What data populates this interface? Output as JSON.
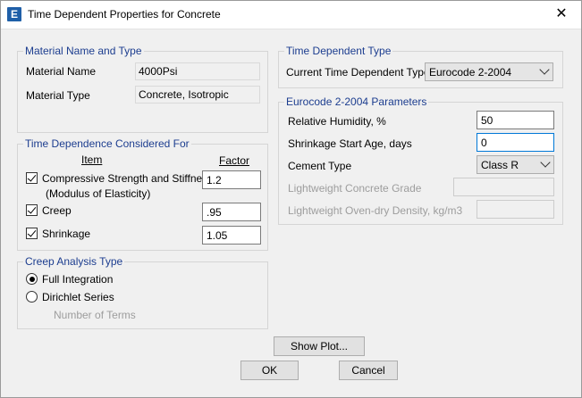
{
  "window": {
    "title": "Time Dependent Properties for Concrete",
    "icon_letter": "E",
    "icon": "etabs-app-icon",
    "close": "✕"
  },
  "material": {
    "group_title": "Material Name and Type",
    "name_label": "Material Name",
    "name_value": "4000Psi",
    "type_label": "Material Type",
    "type_value": "Concrete, Isotropic"
  },
  "time_dependence": {
    "group_title": "Time Dependence Considered For",
    "item_header": "Item",
    "factor_header": "Factor",
    "items": [
      {
        "label": "Compressive Strength and Stiffness",
        "label2": "(Modulus of Elasticity)",
        "checked": true,
        "factor": "1.2"
      },
      {
        "label": "Creep",
        "checked": true,
        "factor": ".95"
      },
      {
        "label": "Shrinkage",
        "checked": true,
        "factor": "1.05"
      }
    ]
  },
  "creep": {
    "group_title": "Creep Analysis Type",
    "options": [
      {
        "label": "Full Integration",
        "selected": true
      },
      {
        "label": "Dirichlet Series",
        "selected": false
      }
    ],
    "terms_label": "Number of Terms"
  },
  "time_dependent_type": {
    "group_title": "Time Dependent Type",
    "current_label": "Current Time Dependent Type",
    "current_value": "Eurocode 2-2004"
  },
  "eurocode": {
    "group_title": "Eurocode 2-2004 Parameters",
    "humidity_label": "Relative Humidity, %",
    "humidity_value": "50",
    "shrinkage_label": "Shrinkage Start Age, days",
    "shrinkage_value": "0",
    "cement_label": "Cement Type",
    "cement_value": "Class R",
    "lw_grade_label": "Lightweight Concrete Grade",
    "lw_density_label": "Lightweight Oven-dry Density, kg/m3"
  },
  "buttons": {
    "show_plot": "Show Plot...",
    "ok": "OK",
    "cancel": "Cancel"
  }
}
